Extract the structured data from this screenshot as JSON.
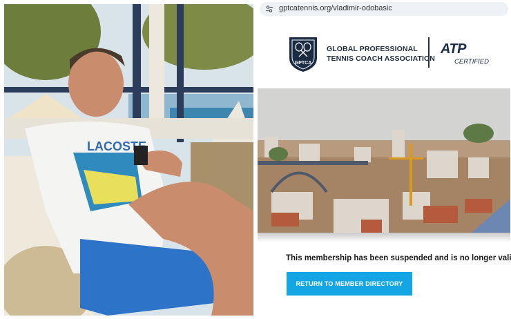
{
  "browser": {
    "url": "gptcatennis.org/vladimir-odobasic",
    "url_icon": "site-settings-icon"
  },
  "header": {
    "badge_text": "GPTCA",
    "org_line1": "GLOBAL PROFESSIONAL",
    "org_line2": "TENNIS COACH ASSOCIATION",
    "atp_text": "ATP",
    "atp_sub": "CERTIFIED"
  },
  "main": {
    "status_message": "This membership has been suspended and is no longer valid.",
    "return_button_label": "RETURN TO MEMBER DIRECTORY"
  },
  "colors": {
    "accent_button": "#14a6e4",
    "brand_navy": "#1a2b44"
  }
}
